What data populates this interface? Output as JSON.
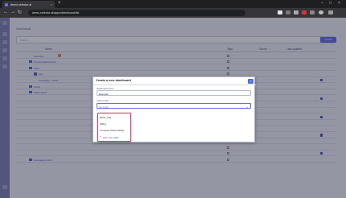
{
  "browser": {
    "tab_title": "demo.selector.ai",
    "tab_close": "×",
    "new_tab": "+",
    "url": "demo.selector.ai/apps/dashboard/list",
    "win_min": "–",
    "win_max": "□",
    "win_close": "×",
    "back": "←",
    "forward": "→",
    "reload": "↻"
  },
  "app": {
    "breadcrumb": "Dashboards",
    "filter_placeholder": "Search",
    "create_button": "Create",
    "columns": [
      "Name",
      "Tags",
      "Owner",
      "Last updated"
    ],
    "rows": [
      {
        "name": "Favorites",
        "owner": "",
        "date": "",
        "indent": 0,
        "kind": "fav"
      },
      {
        "name": "Canned Dashboards",
        "owner": "",
        "date": "",
        "indent": 0,
        "kind": "folder"
      },
      {
        "name": "Apps",
        "owner": "",
        "date": "",
        "indent": 0,
        "kind": "folder"
      },
      {
        "name": "App",
        "owner": "",
        "date": "",
        "indent": 1,
        "kind": "folder"
      },
      {
        "name": "Campaign - Outlet",
        "owner": "",
        "date": "",
        "indent": 1,
        "kind": "item"
      },
      {
        "name": "Cloud",
        "owner": "",
        "date": "",
        "indent": 0,
        "kind": "folder"
      },
      {
        "name": "AWS Cloud",
        "owner": "",
        "date": "",
        "indent": 0,
        "kind": "folder"
      },
      {
        "name": "",
        "owner": "",
        "date": "",
        "indent": 1,
        "kind": "item"
      },
      {
        "name": "",
        "owner": "",
        "date": "",
        "indent": 1,
        "kind": "item"
      },
      {
        "name": "",
        "owner": "",
        "date": "",
        "indent": 1,
        "kind": "item"
      },
      {
        "name": "",
        "owner": "",
        "date": "",
        "indent": 1,
        "kind": "item"
      },
      {
        "name": "",
        "owner": "",
        "date": "",
        "indent": 1,
        "kind": "item"
      },
      {
        "name": "",
        "owner": "",
        "date": "",
        "indent": 1,
        "kind": "item"
      },
      {
        "name": "",
        "owner": "",
        "date": "",
        "indent": 1,
        "kind": "item"
      },
      {
        "name": "",
        "owner": "",
        "date": "",
        "indent": 1,
        "kind": "item"
      },
      {
        "name": "",
        "owner": "",
        "date": "",
        "indent": 1,
        "kind": "item"
      },
      {
        "name": "",
        "owner": "",
        "date": "",
        "indent": 1,
        "kind": "item"
      },
      {
        "name": "Campaign Action",
        "owner": "",
        "date": "",
        "indent": 0,
        "kind": "folder"
      }
    ]
  },
  "modal": {
    "title": "Create a new dashboard",
    "close_icon": "×",
    "name_label": "Dashboard name",
    "name_value": "Example",
    "folder_label": "Select folder",
    "folder_placeholder": "No folder",
    "caret": "⌄",
    "folder_options": [
      "[RVN_UG]",
      "[Wku]",
      "Compute Observability"
    ],
    "add_folder_label": "Add new folder",
    "add_icon": "+"
  },
  "colors": {
    "accent": "#5c6be8",
    "sidebar": "#7a7fb0",
    "dropdown_border": "#c23c5a"
  }
}
